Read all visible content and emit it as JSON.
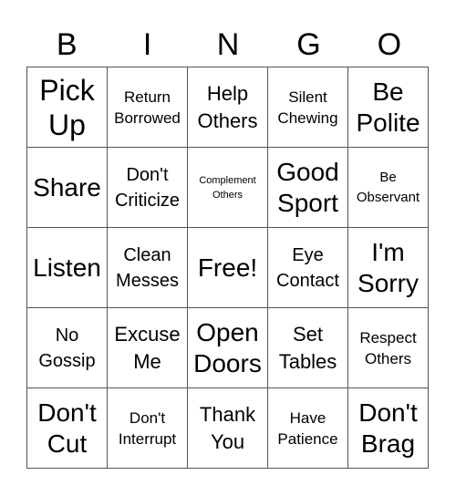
{
  "header": {
    "letters": [
      "B",
      "I",
      "N",
      "G",
      "O"
    ]
  },
  "cells": [
    {
      "text": "Pick Up",
      "size": "xl"
    },
    {
      "text": "Return Borrowed",
      "size": "s"
    },
    {
      "text": "Help Others",
      "size": "m"
    },
    {
      "text": "Silent Chewing",
      "size": "s"
    },
    {
      "text": "Be Polite",
      "size": "l"
    },
    {
      "text": "Share",
      "size": "l"
    },
    {
      "text": "Don't Criticize",
      "size": "ms"
    },
    {
      "text": "Complement Others",
      "size": "xxs"
    },
    {
      "text": "Good Sport",
      "size": "l"
    },
    {
      "text": "Be Observant",
      "size": "xs"
    },
    {
      "text": "Listen",
      "size": "l"
    },
    {
      "text": "Clean Messes",
      "size": "ms"
    },
    {
      "text": "Free!",
      "size": "l"
    },
    {
      "text": "Eye Contact",
      "size": "ms"
    },
    {
      "text": "I'm Sorry",
      "size": "l"
    },
    {
      "text": "No Gossip",
      "size": "ms"
    },
    {
      "text": "Excuse Me",
      "size": "m"
    },
    {
      "text": "Open Doors",
      "size": "l"
    },
    {
      "text": "Set Tables",
      "size": "m"
    },
    {
      "text": "Respect Others",
      "size": "s"
    },
    {
      "text": "Don't Cut",
      "size": "l"
    },
    {
      "text": "Don't Interrupt",
      "size": "s"
    },
    {
      "text": "Thank You",
      "size": "m"
    },
    {
      "text": "Have Patience",
      "size": "s"
    },
    {
      "text": "Don't Brag",
      "size": "l"
    }
  ]
}
